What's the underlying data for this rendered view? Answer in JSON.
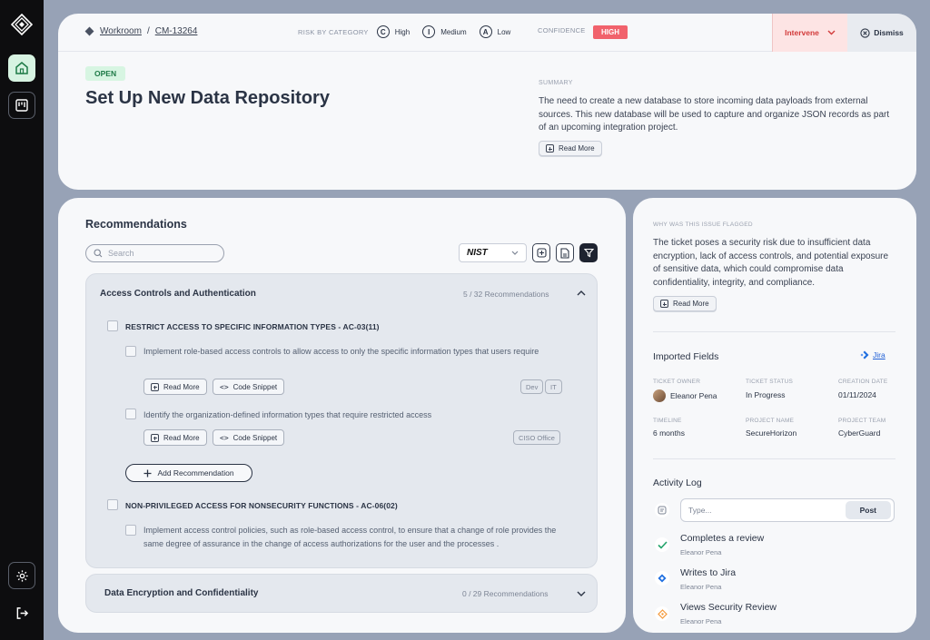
{
  "breadcrumb": {
    "root": "Workroom",
    "separator": "/",
    "ticket_id": "CM-13264"
  },
  "risk": {
    "label": "RISK BY CATEGORY",
    "items": [
      {
        "letter": "C",
        "label": "High"
      },
      {
        "letter": "I",
        "label": "Medium"
      },
      {
        "letter": "A",
        "label": "Low"
      }
    ]
  },
  "confidence": {
    "label": "CONFIDENCE",
    "value": "HIGH",
    "color": "#f1626c"
  },
  "actions": {
    "intervene": "Intervene",
    "dismiss": "Dismiss"
  },
  "issue": {
    "status": "OPEN",
    "title": "Set Up New Data Repository",
    "summary_label": "SUMMARY",
    "summary": "The need to create a new database to store incoming data payloads from external sources. This new database will be used to capture and organize JSON records as part of an upcoming integration project.",
    "read_more": "Read More"
  },
  "recommendations": {
    "title": "Recommendations",
    "search_placeholder": "Search",
    "framework": "NIST",
    "groups": [
      {
        "name": "Access Controls and Authentication",
        "count": "5 / 32 Recommendations",
        "controls": [
          {
            "title": "RESTRICT ACCESS TO SPECIFIC INFORMATION TYPES - AC-03(11)",
            "items": [
              {
                "text": "Implement role-based access controls to allow access to only the specific information types that users require",
                "tags": [
                  "Dev",
                  "IT"
                ]
              },
              {
                "text": "Identify the organization-defined information types that require restricted access",
                "tags": [
                  "CISO Office"
                ]
              }
            ]
          },
          {
            "title": "NON-PRIVILEGED ACCESS FOR NONSECURITY FUNCTIONS - AC-06(02)",
            "items": [
              {
                "text": "Implement access control policies, such as role-based access control, to ensure that a change of role provides the same degree of assurance in the change of access authorizations for the user and the processes ."
              }
            ]
          }
        ]
      },
      {
        "name": "Data Encryption and Confidentiality",
        "count": "0 / 29 Recommendations"
      }
    ],
    "read_more": "Read More",
    "code_snippet": "Code Snippet",
    "add_recommendation": "Add Recommendation"
  },
  "flag": {
    "label": "WHY WAS THIS ISSUE FLAGGED",
    "text": "The ticket poses a security risk due to insufficient data encryption, lack of access controls, and potential exposure of sensitive data, which could compromise data confidentiality, integrity, and compliance.",
    "read_more": "Read More"
  },
  "imported": {
    "title": "Imported Fields",
    "source": "Jira",
    "fields": {
      "owner_label": "TICKET OWNER",
      "owner": "Eleanor Pena",
      "status_label": "TICKET STATUS",
      "status": "In Progress",
      "created_label": "CREATION DATE",
      "created": "01/11/2024",
      "timeline_label": "TIMELINE",
      "timeline": "6 months",
      "project_label": "PROJECT NAME",
      "project": "SecureHorizon",
      "team_label": "PROJECT TEAM",
      "team": "CyberGuard"
    }
  },
  "activity": {
    "title": "Activity Log",
    "input_placeholder": "Type...",
    "post": "Post",
    "entries": [
      {
        "title": "Completes a review",
        "user": "Eleanor Pena",
        "icon": "check-icon",
        "color": "#22a36a"
      },
      {
        "title": "Writes to Jira",
        "user": "Eleanor Pena",
        "icon": "jira-icon",
        "color": "#1f6fe0"
      },
      {
        "title": "Views Security Review",
        "user": "Eleanor Pena",
        "icon": "review-icon",
        "color": "#f59a3c"
      }
    ]
  }
}
